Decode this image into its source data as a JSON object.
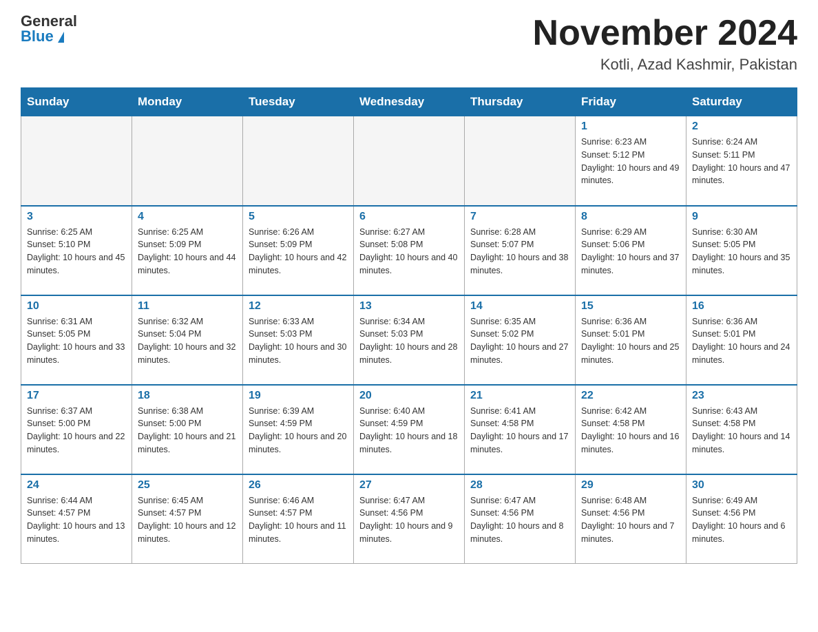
{
  "header": {
    "logo_line1": "General",
    "logo_line2": "Blue",
    "month": "November 2024",
    "location": "Kotli, Azad Kashmir, Pakistan"
  },
  "weekdays": [
    "Sunday",
    "Monday",
    "Tuesday",
    "Wednesday",
    "Thursday",
    "Friday",
    "Saturday"
  ],
  "weeks": [
    [
      {
        "day": "",
        "empty": true
      },
      {
        "day": "",
        "empty": true
      },
      {
        "day": "",
        "empty": true
      },
      {
        "day": "",
        "empty": true
      },
      {
        "day": "",
        "empty": true
      },
      {
        "day": "1",
        "sunrise": "Sunrise: 6:23 AM",
        "sunset": "Sunset: 5:12 PM",
        "daylight": "Daylight: 10 hours and 49 minutes."
      },
      {
        "day": "2",
        "sunrise": "Sunrise: 6:24 AM",
        "sunset": "Sunset: 5:11 PM",
        "daylight": "Daylight: 10 hours and 47 minutes."
      }
    ],
    [
      {
        "day": "3",
        "sunrise": "Sunrise: 6:25 AM",
        "sunset": "Sunset: 5:10 PM",
        "daylight": "Daylight: 10 hours and 45 minutes."
      },
      {
        "day": "4",
        "sunrise": "Sunrise: 6:25 AM",
        "sunset": "Sunset: 5:09 PM",
        "daylight": "Daylight: 10 hours and 44 minutes."
      },
      {
        "day": "5",
        "sunrise": "Sunrise: 6:26 AM",
        "sunset": "Sunset: 5:09 PM",
        "daylight": "Daylight: 10 hours and 42 minutes."
      },
      {
        "day": "6",
        "sunrise": "Sunrise: 6:27 AM",
        "sunset": "Sunset: 5:08 PM",
        "daylight": "Daylight: 10 hours and 40 minutes."
      },
      {
        "day": "7",
        "sunrise": "Sunrise: 6:28 AM",
        "sunset": "Sunset: 5:07 PM",
        "daylight": "Daylight: 10 hours and 38 minutes."
      },
      {
        "day": "8",
        "sunrise": "Sunrise: 6:29 AM",
        "sunset": "Sunset: 5:06 PM",
        "daylight": "Daylight: 10 hours and 37 minutes."
      },
      {
        "day": "9",
        "sunrise": "Sunrise: 6:30 AM",
        "sunset": "Sunset: 5:05 PM",
        "daylight": "Daylight: 10 hours and 35 minutes."
      }
    ],
    [
      {
        "day": "10",
        "sunrise": "Sunrise: 6:31 AM",
        "sunset": "Sunset: 5:05 PM",
        "daylight": "Daylight: 10 hours and 33 minutes."
      },
      {
        "day": "11",
        "sunrise": "Sunrise: 6:32 AM",
        "sunset": "Sunset: 5:04 PM",
        "daylight": "Daylight: 10 hours and 32 minutes."
      },
      {
        "day": "12",
        "sunrise": "Sunrise: 6:33 AM",
        "sunset": "Sunset: 5:03 PM",
        "daylight": "Daylight: 10 hours and 30 minutes."
      },
      {
        "day": "13",
        "sunrise": "Sunrise: 6:34 AM",
        "sunset": "Sunset: 5:03 PM",
        "daylight": "Daylight: 10 hours and 28 minutes."
      },
      {
        "day": "14",
        "sunrise": "Sunrise: 6:35 AM",
        "sunset": "Sunset: 5:02 PM",
        "daylight": "Daylight: 10 hours and 27 minutes."
      },
      {
        "day": "15",
        "sunrise": "Sunrise: 6:36 AM",
        "sunset": "Sunset: 5:01 PM",
        "daylight": "Daylight: 10 hours and 25 minutes."
      },
      {
        "day": "16",
        "sunrise": "Sunrise: 6:36 AM",
        "sunset": "Sunset: 5:01 PM",
        "daylight": "Daylight: 10 hours and 24 minutes."
      }
    ],
    [
      {
        "day": "17",
        "sunrise": "Sunrise: 6:37 AM",
        "sunset": "Sunset: 5:00 PM",
        "daylight": "Daylight: 10 hours and 22 minutes."
      },
      {
        "day": "18",
        "sunrise": "Sunrise: 6:38 AM",
        "sunset": "Sunset: 5:00 PM",
        "daylight": "Daylight: 10 hours and 21 minutes."
      },
      {
        "day": "19",
        "sunrise": "Sunrise: 6:39 AM",
        "sunset": "Sunset: 4:59 PM",
        "daylight": "Daylight: 10 hours and 20 minutes."
      },
      {
        "day": "20",
        "sunrise": "Sunrise: 6:40 AM",
        "sunset": "Sunset: 4:59 PM",
        "daylight": "Daylight: 10 hours and 18 minutes."
      },
      {
        "day": "21",
        "sunrise": "Sunrise: 6:41 AM",
        "sunset": "Sunset: 4:58 PM",
        "daylight": "Daylight: 10 hours and 17 minutes."
      },
      {
        "day": "22",
        "sunrise": "Sunrise: 6:42 AM",
        "sunset": "Sunset: 4:58 PM",
        "daylight": "Daylight: 10 hours and 16 minutes."
      },
      {
        "day": "23",
        "sunrise": "Sunrise: 6:43 AM",
        "sunset": "Sunset: 4:58 PM",
        "daylight": "Daylight: 10 hours and 14 minutes."
      }
    ],
    [
      {
        "day": "24",
        "sunrise": "Sunrise: 6:44 AM",
        "sunset": "Sunset: 4:57 PM",
        "daylight": "Daylight: 10 hours and 13 minutes."
      },
      {
        "day": "25",
        "sunrise": "Sunrise: 6:45 AM",
        "sunset": "Sunset: 4:57 PM",
        "daylight": "Daylight: 10 hours and 12 minutes."
      },
      {
        "day": "26",
        "sunrise": "Sunrise: 6:46 AM",
        "sunset": "Sunset: 4:57 PM",
        "daylight": "Daylight: 10 hours and 11 minutes."
      },
      {
        "day": "27",
        "sunrise": "Sunrise: 6:47 AM",
        "sunset": "Sunset: 4:56 PM",
        "daylight": "Daylight: 10 hours and 9 minutes."
      },
      {
        "day": "28",
        "sunrise": "Sunrise: 6:47 AM",
        "sunset": "Sunset: 4:56 PM",
        "daylight": "Daylight: 10 hours and 8 minutes."
      },
      {
        "day": "29",
        "sunrise": "Sunrise: 6:48 AM",
        "sunset": "Sunset: 4:56 PM",
        "daylight": "Daylight: 10 hours and 7 minutes."
      },
      {
        "day": "30",
        "sunrise": "Sunrise: 6:49 AM",
        "sunset": "Sunset: 4:56 PM",
        "daylight": "Daylight: 10 hours and 6 minutes."
      }
    ]
  ]
}
